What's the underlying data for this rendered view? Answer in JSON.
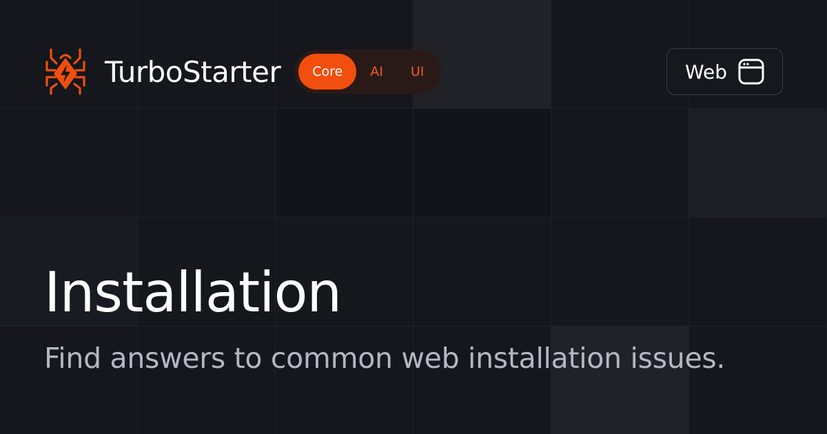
{
  "brand": {
    "name": "TurboStarter",
    "accent_color": "#f24e0f",
    "logo_icon": "spider-bolt-icon"
  },
  "tabs": [
    {
      "label": "Core",
      "active": true
    },
    {
      "label": "AI",
      "active": false
    },
    {
      "label": "UI",
      "active": false
    }
  ],
  "platform": {
    "label": "Web",
    "icon": "browser-window-icon"
  },
  "page": {
    "title": "Installation",
    "subtitle": "Find answers to common web installation issues."
  }
}
